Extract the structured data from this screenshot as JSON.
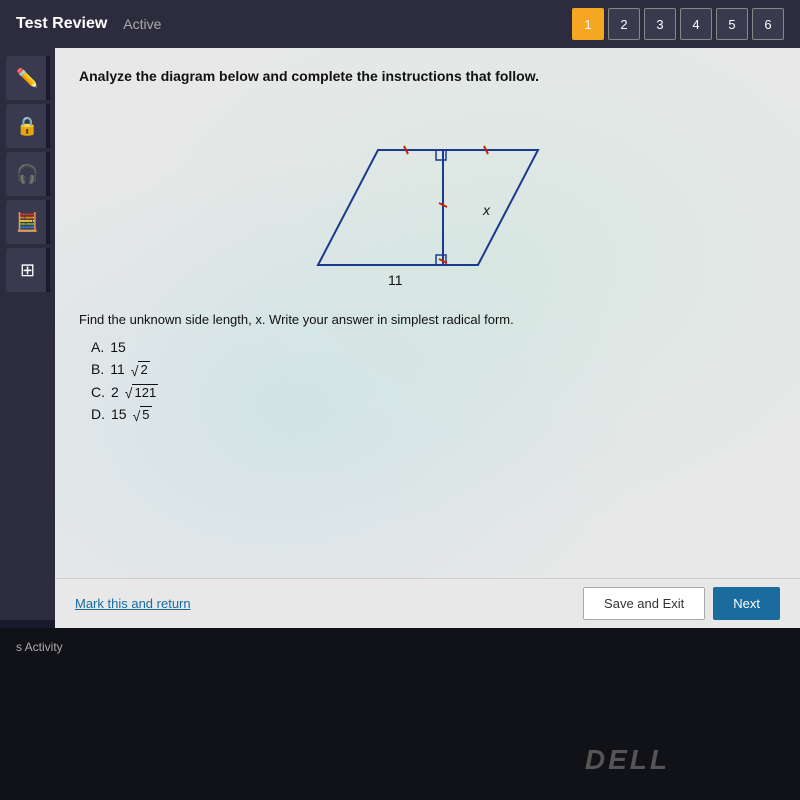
{
  "topbar": {
    "title": "Test Review",
    "status": "Active"
  },
  "question_numbers": [
    {
      "label": "1",
      "active": true
    },
    {
      "label": "2",
      "active": false
    },
    {
      "label": "3",
      "active": false
    },
    {
      "label": "4",
      "active": false
    },
    {
      "label": "5",
      "active": false
    },
    {
      "label": "6",
      "active": false
    }
  ],
  "sidebar": {
    "buttons": [
      {
        "icon": "✏️",
        "name": "pencil"
      },
      {
        "icon": "🔒",
        "name": "lock"
      },
      {
        "icon": "🎧",
        "name": "headphone"
      },
      {
        "icon": "🧮",
        "name": "calculator"
      },
      {
        "icon": "⊞",
        "name": "grid"
      }
    ]
  },
  "question": {
    "prompt": "Analyze the diagram below and complete the instructions that follow.",
    "sub_prompt": "Find the unknown side length, x. Write your answer in simplest radical form.",
    "diagram": {
      "label_11": "11",
      "label_x": "x"
    },
    "choices": [
      {
        "label": "A.",
        "value": "15"
      },
      {
        "label": "B.",
        "value": "11√2"
      },
      {
        "label": "C.",
        "value": "2√121"
      },
      {
        "label": "D.",
        "value": "15√5"
      }
    ]
  },
  "actions": {
    "mark_return": "Mark this and return",
    "save_exit": "Save and Exit",
    "next": "Next"
  },
  "bottom": {
    "activity_label": "s Activity"
  },
  "dell_logo": "DELL"
}
